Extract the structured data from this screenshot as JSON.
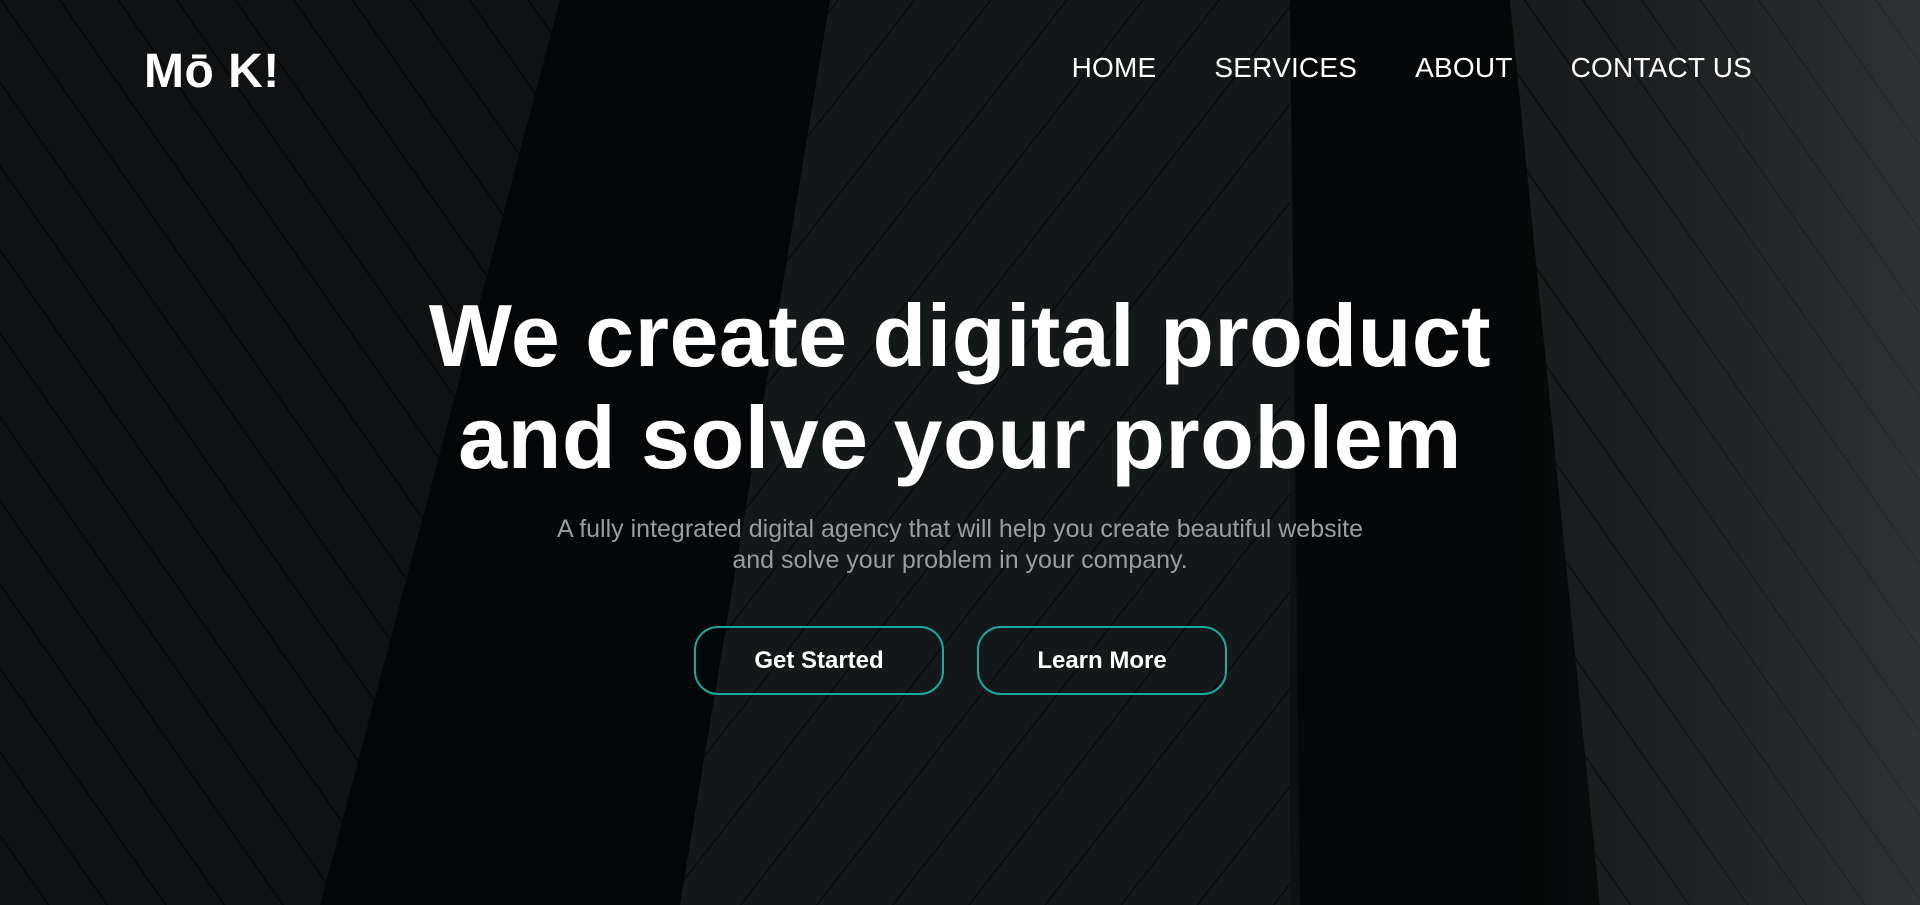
{
  "brand": {
    "logo_text": "Mō K!"
  },
  "nav": {
    "items": [
      {
        "label": "HOME"
      },
      {
        "label": "SERVICES"
      },
      {
        "label": "ABOUT"
      },
      {
        "label": "CONTACT US"
      }
    ]
  },
  "hero": {
    "headline_line1": "We create digital product",
    "headline_line2": "and solve your problem",
    "subtitle_line1": "A fully integrated digital agency that will help you create beautiful website",
    "subtitle_line2": "and solve your problem in your company.",
    "primary_button": "Get Started",
    "secondary_button": "Learn More"
  },
  "colors": {
    "accent_border": "#1aa99a",
    "text_primary": "#ffffff",
    "text_muted": "#9a9c9e",
    "background": "#0c0e0f"
  }
}
